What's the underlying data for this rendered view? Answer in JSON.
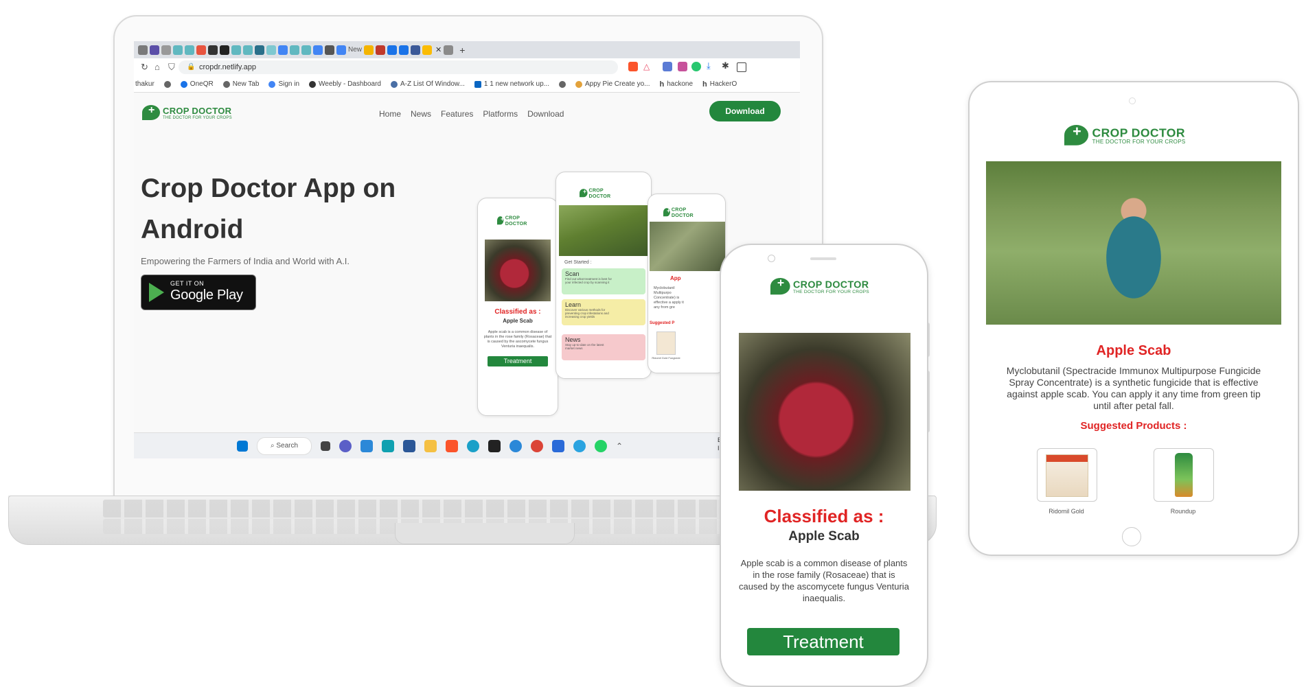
{
  "browser": {
    "url": "cropdr.netlify.app",
    "tab_new_label": "New",
    "bookmarks": [
      "thakur",
      "OneQR",
      "New Tab",
      "Sign in",
      "Weebly - Dashboard",
      "A-Z List Of Window...",
      "1 1 new network up...",
      "Appy Pie Create yo...",
      "hackone",
      "HackerO"
    ]
  },
  "site": {
    "logo_title": "CROP DOCTOR",
    "logo_tagline": "THE DOCTOR FOR YOUR CROPS",
    "nav": [
      "Home",
      "News",
      "Features",
      "Platforms",
      "Download"
    ],
    "download_label": "Download",
    "hero_title": "Crop Doctor App on Android",
    "hero_subtitle": "Empowering the Farmers of India and World with A.I.",
    "gplay_small": "GET IT ON",
    "gplay_big": "Google Play"
  },
  "mini_phone_left": {
    "classified": "Classified as :",
    "disease": "Apple Scab",
    "desc": "Apple scab is a common disease of plants in the rose family (Rosaceae) that is caused by the ascomycete fungus Venturia inaequalis.",
    "treatment": "Treatment"
  },
  "mini_phone_center": {
    "get_started": "Get Started :",
    "cards": [
      {
        "title": "Scan",
        "desc": "Find out what treatment is best for your infected crop by scanning it",
        "color": "#c8f0c8"
      },
      {
        "title": "Learn",
        "desc": "Discover various methods for preventing crop infestations and increasing crop yields",
        "color": "#f5eda6"
      },
      {
        "title": "News",
        "desc": "Stay up-to-date on the latest market news",
        "color": "#f6c9cc"
      }
    ]
  },
  "mini_phone_right": {
    "title": "App",
    "desc": "Myclobutanil Multipurpo Concentrate) is effective a apply it any from gre",
    "suggested": "Suggested P",
    "product": "Ridomil Gold Fungicide"
  },
  "taskbar": {
    "search": "Search",
    "tray_1": "EN",
    "tray_2": "IN"
  },
  "phone": {
    "logo_title": "CROP DOCTOR",
    "logo_tagline": "THE DOCTOR FOR YOUR CROPS",
    "classified": "Classified as :",
    "disease": "Apple Scab",
    "desc": "Apple scab is a common disease of plants in the rose family (Rosaceae) that is caused by the ascomycete fungus Venturia inaequalis.",
    "treatment": "Treatment"
  },
  "tablet": {
    "logo_title": "CROP DOCTOR",
    "logo_tagline": "THE DOCTOR FOR YOUR CROPS",
    "title": "Apple Scab",
    "desc": "Myclobutanil (Spectracide Immunox Multipurpose Fungicide Spray Concentrate) is a synthetic fungicide that is effective against apple scab. You can apply it any time from green tip until after petal fall.",
    "suggested": "Suggested Products :",
    "products": [
      "Ridomil Gold",
      "Roundup"
    ]
  },
  "colors": {
    "brand_green": "#2e8b40",
    "button_green": "#23873d",
    "alert_red": "#e02424"
  }
}
